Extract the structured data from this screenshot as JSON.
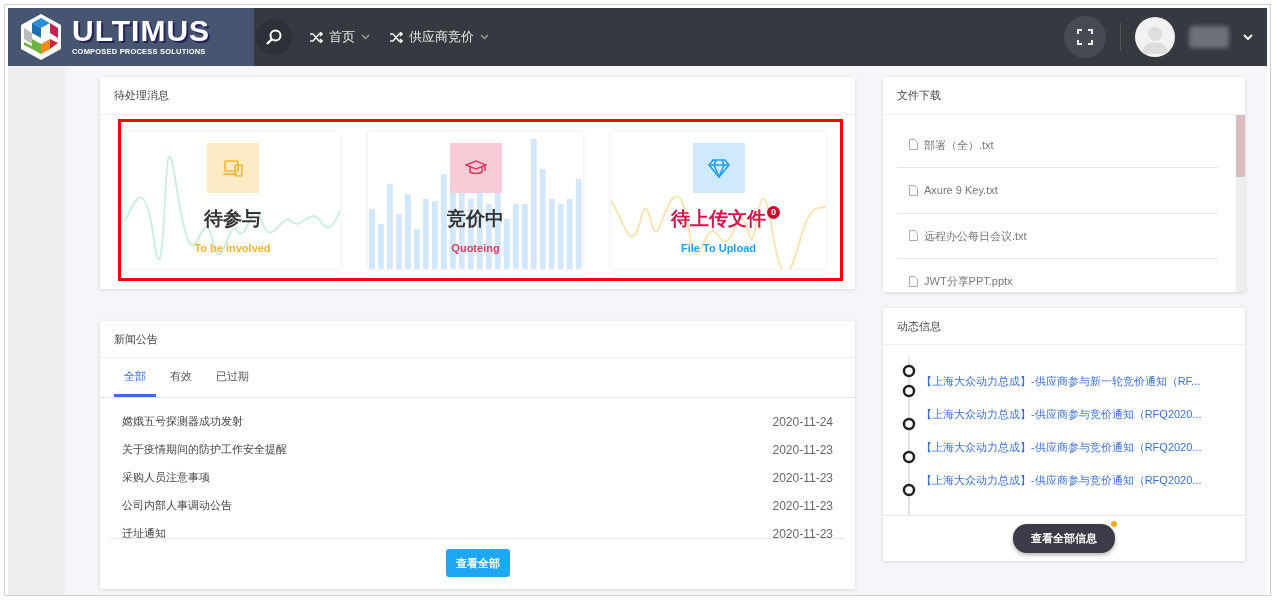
{
  "navbar": {
    "logo": {
      "name": "ULTIMUS",
      "tagline": "COMPOSED PROCESS SOLUTIONS"
    },
    "menus": [
      {
        "label": "首页"
      },
      {
        "label": "供应商竞价"
      }
    ]
  },
  "pending": {
    "title": "待处理消息",
    "tiles": [
      {
        "kind": "wave",
        "title": "待参与",
        "subtitle": "To be involved",
        "color": "#f2b632",
        "alert": false
      },
      {
        "kind": "bars",
        "title": "竞价中",
        "subtitle": "Quoteing",
        "color": "#dc3d63",
        "alert": false
      },
      {
        "kind": "wave",
        "title": "待上传文件",
        "subtitle": "File To Upload",
        "color": "#1fa0ee",
        "alert": true,
        "badge": "0"
      }
    ]
  },
  "files": {
    "title": "文件下载",
    "items": [
      "部署（全）.txt",
      "Axure 9 Key.txt",
      "远程办公每日会议.txt",
      "JWT分享PPT.pptx"
    ]
  },
  "news": {
    "title": "新闻公告",
    "tabs": [
      {
        "label": "全部",
        "selected": true
      },
      {
        "label": "有效",
        "selected": false
      },
      {
        "label": "已过期",
        "selected": false
      }
    ],
    "items": [
      {
        "title": "嫦娥五号探测器成功发射",
        "date": "2020-11-24"
      },
      {
        "title": "关于疫情期间的防护工作安全提醒",
        "date": "2020-11-23"
      },
      {
        "title": "采购人员注意事项",
        "date": "2020-11-23"
      },
      {
        "title": "公司内部人事调动公告",
        "date": "2020-11-23"
      },
      {
        "title": "迁址通知",
        "date": "2020-11-23"
      }
    ],
    "button": "查看全部"
  },
  "activity": {
    "title": "动态信息",
    "items": [
      "【上海大众动力总成】-供应商参与新一轮竞价通知（RF...",
      "【上海大众动力总成】-供应商参与竞价通知（RFQ2020...",
      "【上海大众动力总成】-供应商参与竞价通知（RFQ2020...",
      "【上海大众动力总成】-供应商参与竞价通知（RFQ2020..."
    ],
    "button": "查看全部信息"
  }
}
